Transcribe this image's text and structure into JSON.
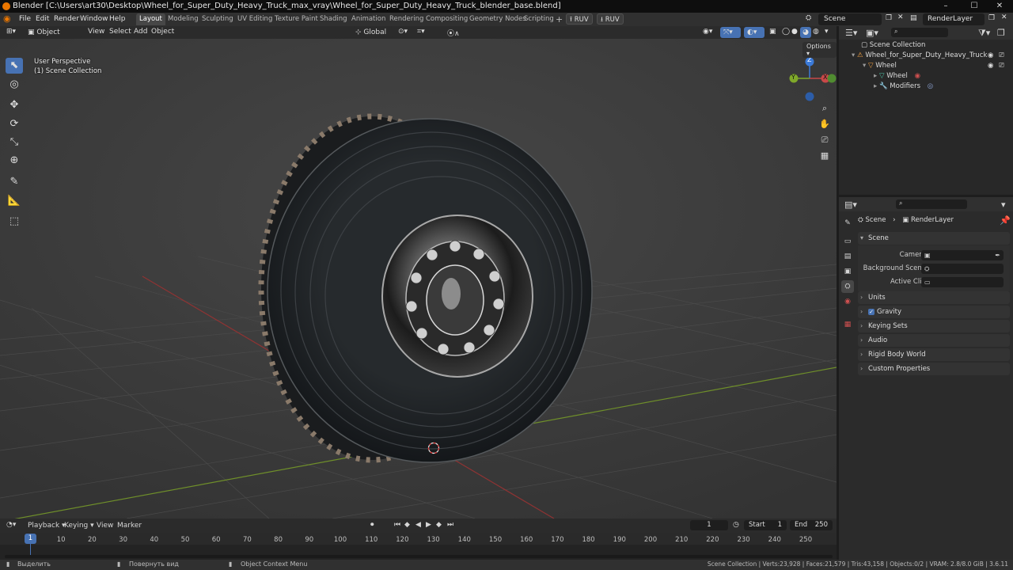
{
  "window": {
    "title": "Blender [C:\\Users\\art30\\Desktop\\Wheel_for_Super_Duty_Heavy_Truck_max_vray\\Wheel_for_Super_Duty_Heavy_Truck_blender_base.blend]",
    "controls": {
      "minimize": "–",
      "maximize": "☐",
      "close": "✕"
    }
  },
  "menu": [
    "File",
    "Edit",
    "Render",
    "Window",
    "Help"
  ],
  "workspaces": {
    "tabs": [
      "Layout",
      "Modeling",
      "Sculpting",
      "UV Editing",
      "Texture Paint",
      "Shading",
      "Animation",
      "Rendering",
      "Compositing",
      "Geometry Nodes",
      "Scripting"
    ],
    "active": "Layout",
    "add": "+"
  },
  "addons": {
    "ruv1": "RUV",
    "ruv2": "RUV"
  },
  "scene_selector": {
    "scene": "Scene",
    "view_layer": "RenderLayer"
  },
  "viewport_header": {
    "mode": "Object Mode",
    "menus": [
      "View",
      "Select",
      "Add",
      "Object"
    ],
    "orientation": "Global",
    "options": "Options"
  },
  "viewport": {
    "perspective": "User Perspective",
    "collection": "(1) Scene Collection",
    "gizmo": {
      "x": "X",
      "y": "Y",
      "z": "Z"
    }
  },
  "outliner": {
    "root": "Scene Collection",
    "items": [
      {
        "label": "Wheel_for_Super_Duty_Heavy_Truck",
        "depth": 1
      },
      {
        "label": "Wheel",
        "depth": 2
      },
      {
        "label": "Wheel",
        "depth": 3
      },
      {
        "label": "Modifiers",
        "depth": 3
      }
    ]
  },
  "properties": {
    "breadcrumb": {
      "scene": "Scene",
      "layer": "RenderLayer"
    },
    "scene_panel": {
      "title": "Scene",
      "fields": [
        {
          "label": "Camera",
          "value": ""
        },
        {
          "label": "Background Scene",
          "value": ""
        },
        {
          "label": "Active Clip",
          "value": ""
        }
      ]
    },
    "panels": [
      "Units",
      "Gravity",
      "Keying Sets",
      "Audio",
      "Rigid Body World",
      "Custom Properties"
    ],
    "gravity_checked": true
  },
  "timeline": {
    "menus": [
      "Playback",
      "Keying",
      "View",
      "Marker"
    ],
    "current_frame": "1",
    "start_label": "Start",
    "start": "1",
    "end_label": "End",
    "end": "250",
    "ruler": [
      "10",
      "20",
      "30",
      "40",
      "50",
      "60",
      "70",
      "80",
      "90",
      "100",
      "110",
      "120",
      "130",
      "140",
      "150",
      "160",
      "170",
      "180",
      "190",
      "200",
      "210",
      "220",
      "230",
      "240",
      "250"
    ],
    "playhead": "1"
  },
  "statusbar": {
    "select": "Выделить",
    "rotate": "Повернуть вид",
    "context": "Object Context Menu",
    "stats": "Scene Collection | Verts:23,928 | Faces:21,579 | Tris:43,158 | Objects:0/2 | VRAM: 2.8/8.0 GiB | 3.6.11"
  }
}
